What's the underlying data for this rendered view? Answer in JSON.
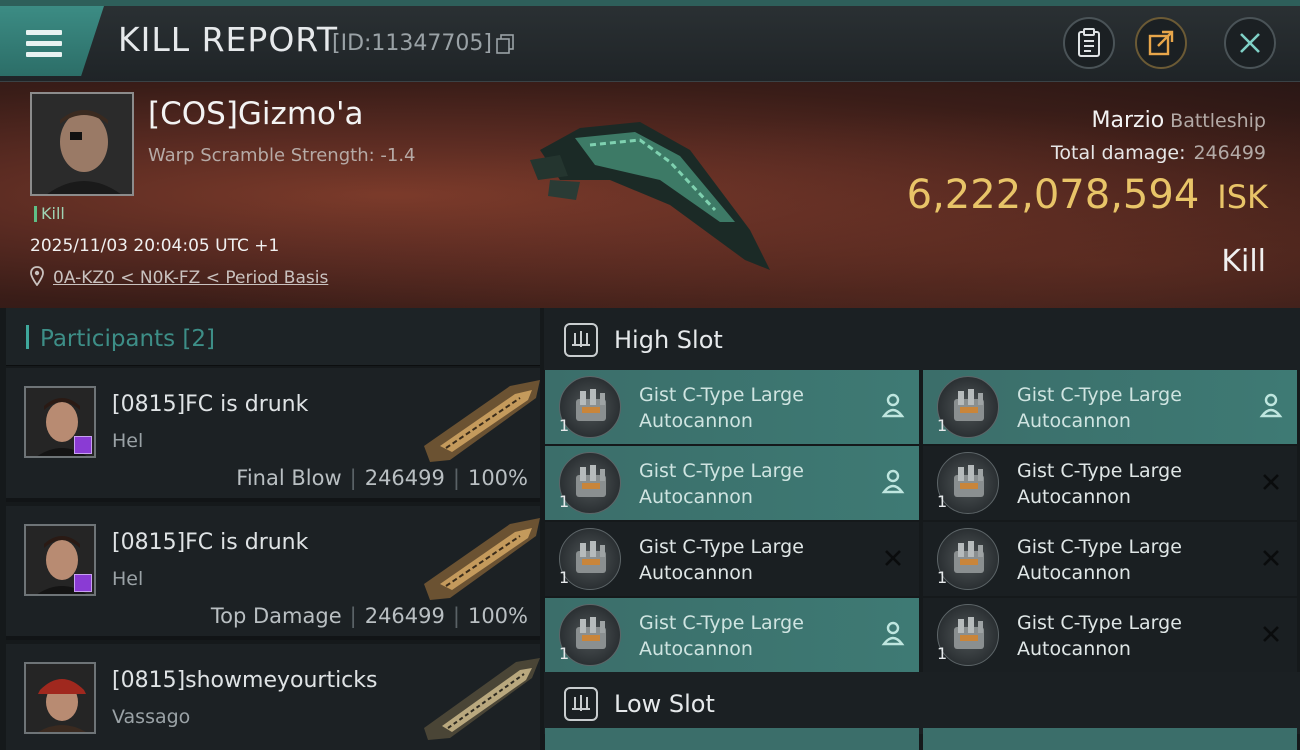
{
  "header": {
    "title": "KILL REPORT",
    "report_id": "[ID:11347705]"
  },
  "victim": {
    "name": "[COS]Gizmo'a",
    "warp_scramble": "Warp Scramble Strength: -1.4",
    "tag": "Kill",
    "timestamp": "2025/11/03 20:04:05 UTC +1",
    "location": "0A-KZ0 < N0K-FZ < Period Basis",
    "ship_name": "Marzio",
    "ship_class": "Battleship",
    "total_damage_label": "Total damage:",
    "total_damage": "246499",
    "isk_value": "6,222,078,594",
    "isk_unit": "ISK",
    "result": "Kill"
  },
  "participants": {
    "header": "Participants [2]",
    "rows": [
      {
        "name": "[0815]FC is drunk",
        "ship": "Hel",
        "role": "Final Blow",
        "damage": "246499",
        "percent": "100%"
      },
      {
        "name": "[0815]FC is drunk",
        "ship": "Hel",
        "role": "Top Damage",
        "damage": "246499",
        "percent": "100%"
      },
      {
        "name": "[0815]showmeyourticks",
        "ship": "Vassago"
      }
    ]
  },
  "slots": {
    "high_label": "High Slot",
    "low_label": "Low Slot",
    "high_modules": [
      {
        "name": "Gist C-Type Large Autocannon",
        "qty": "1",
        "state": "dropped"
      },
      {
        "name": "Gist C-Type Large Autocannon",
        "qty": "1",
        "state": "dropped"
      },
      {
        "name": "Gist C-Type Large Autocannon",
        "qty": "1",
        "state": "dropped"
      },
      {
        "name": "Gist C-Type Large Autocannon",
        "qty": "1",
        "state": "destroyed"
      },
      {
        "name": "Gist C-Type Large Autocannon",
        "qty": "1",
        "state": "destroyed"
      },
      {
        "name": "Gist C-Type Large Autocannon",
        "qty": "1",
        "state": "destroyed"
      },
      {
        "name": "Gist C-Type Large Autocannon",
        "qty": "1",
        "state": "dropped"
      },
      {
        "name": "Gist C-Type Large Autocannon",
        "qty": "1",
        "state": "destroyed"
      }
    ]
  },
  "icons": {
    "menu": "menu-icon",
    "copy": "copy-icon",
    "clipboard": "clipboard-icon",
    "share": "share-icon",
    "close": "close-icon",
    "location": "location-pin-icon",
    "dropped": "person-icon",
    "destroyed": "x-icon"
  },
  "colors": {
    "accent_teal": "#3fa89c",
    "isk_gold": "#e8c468",
    "dropped_module": "#3e7a74",
    "kill_green": "#5fbf86"
  }
}
